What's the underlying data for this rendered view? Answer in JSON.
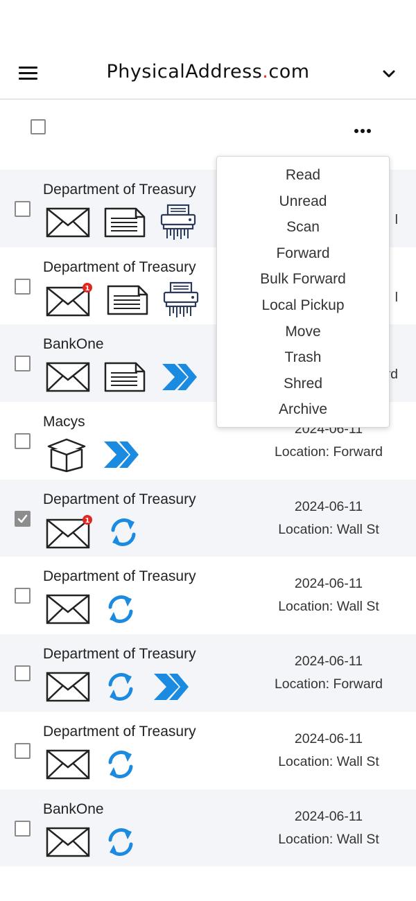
{
  "header": {
    "brand_part1": "PhysicalAddress",
    "brand_dot": ".",
    "brand_part2": "com",
    "brand_dot_color": "#e0302a"
  },
  "menu": {
    "items": [
      "Read",
      "Unread",
      "Scan",
      "Forward",
      "Bulk Forward",
      "Local Pickup",
      "Move",
      "Trash",
      "Shred",
      "Archive"
    ]
  },
  "mail": [
    {
      "sender": "Department of Treasury",
      "date": "",
      "location": "",
      "icons": [
        "envelope-icon",
        "document-icon",
        "shred-icon"
      ],
      "checked": false,
      "partial_right_text": "l"
    },
    {
      "sender": "Department of Treasury",
      "date": "",
      "location": "",
      "icons": [
        "envelope-unread-icon",
        "document-icon",
        "shred-icon"
      ],
      "checked": false,
      "partial_right_text": "l"
    },
    {
      "sender": "BankOne",
      "date": "",
      "location": "",
      "icons": [
        "envelope-icon",
        "document-icon",
        "forward-icon"
      ],
      "checked": false,
      "partial_right_text": "rd"
    },
    {
      "sender": "Macys",
      "date": "2024-06-11",
      "location": "Location: Forward",
      "icons": [
        "package-icon",
        "forward-icon"
      ],
      "checked": false
    },
    {
      "sender": "Department of Treasury",
      "date": "2024-06-11",
      "location": "Location: Wall St",
      "icons": [
        "envelope-unread-icon",
        "sync-icon"
      ],
      "checked": true
    },
    {
      "sender": "Department of Treasury",
      "date": "2024-06-11",
      "location": "Location: Wall St",
      "icons": [
        "envelope-icon",
        "sync-icon"
      ],
      "checked": false
    },
    {
      "sender": "Department of Treasury",
      "date": "2024-06-11",
      "location": "Location: Forward",
      "icons": [
        "envelope-icon",
        "sync-icon",
        "forward-icon"
      ],
      "checked": false
    },
    {
      "sender": "Department of Treasury",
      "date": "2024-06-11",
      "location": "Location: Wall St",
      "icons": [
        "envelope-icon",
        "sync-icon"
      ],
      "checked": false
    },
    {
      "sender": "BankOne",
      "date": "2024-06-11",
      "location": "Location: Wall St",
      "icons": [
        "envelope-icon",
        "sync-icon"
      ],
      "checked": false
    }
  ],
  "colors": {
    "accent_blue": "#1a8be0",
    "badge_red": "#e3261f",
    "row_shade": "#f3f5f8"
  }
}
